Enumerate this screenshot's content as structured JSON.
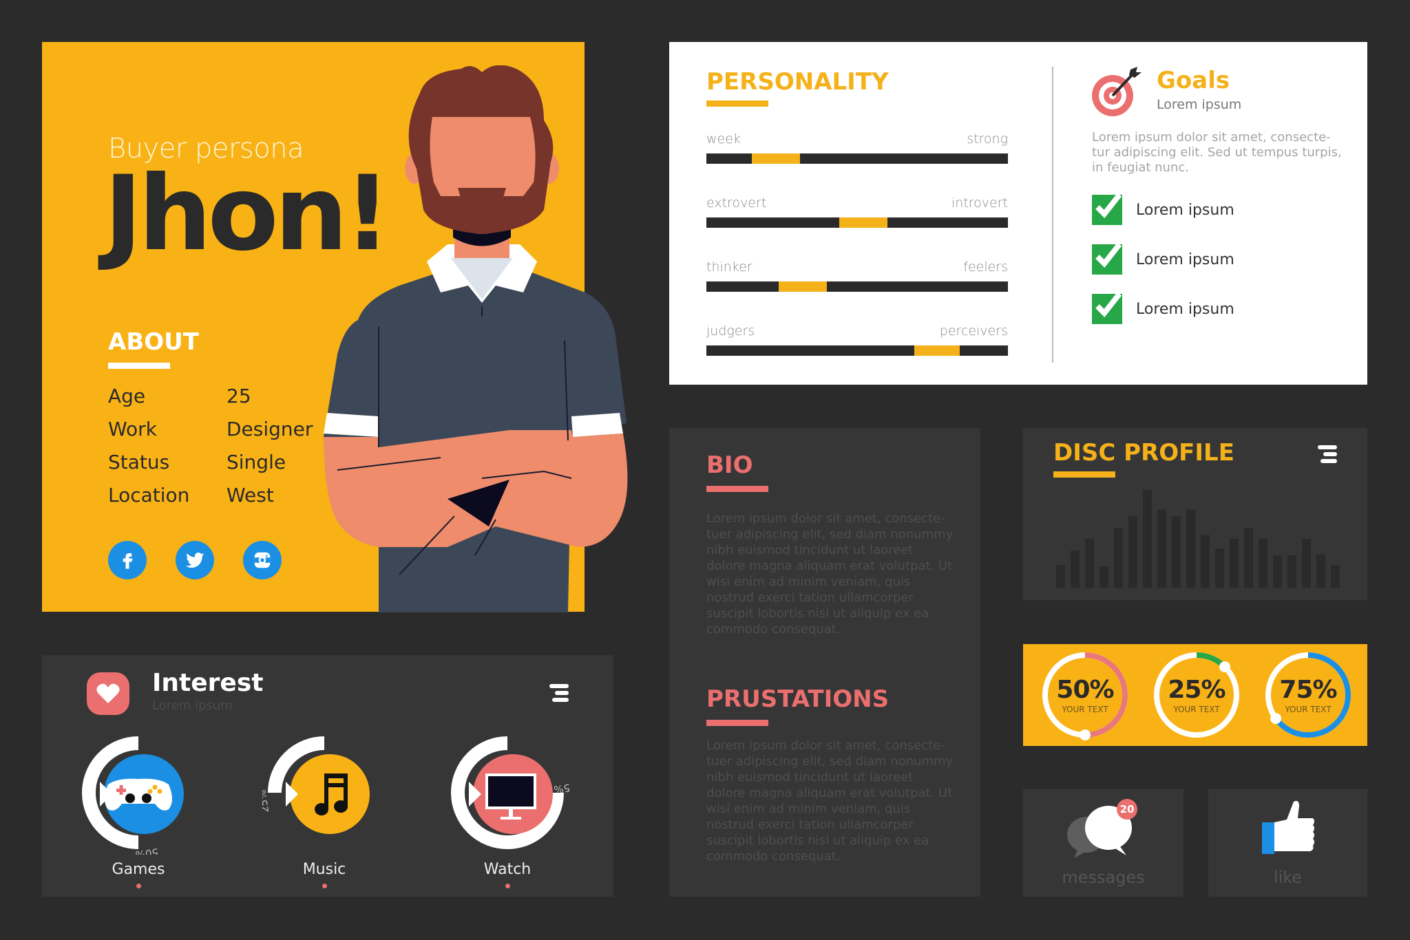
{
  "hero": {
    "subtitle": "Buyer persona",
    "name": "Jhon!",
    "about_heading": "ABOUT",
    "about": [
      {
        "label": "Age",
        "value": "25"
      },
      {
        "label": "Work",
        "value": "Designer"
      },
      {
        "label": "Status",
        "value": "Single"
      },
      {
        "label": "Location",
        "value": "West"
      }
    ],
    "social": [
      {
        "icon": "facebook-icon"
      },
      {
        "icon": "twitter-icon"
      },
      {
        "icon": "instagram-icon"
      }
    ]
  },
  "personality": {
    "title": "PERSONALITY",
    "traits": [
      {
        "left": "week",
        "right": "strong",
        "start": 0.15,
        "end": 0.31
      },
      {
        "left": "extrovert",
        "right": "introvert",
        "start": 0.44,
        "end": 0.6
      },
      {
        "left": "thinker",
        "right": "feelers",
        "start": 0.24,
        "end": 0.4
      },
      {
        "left": "judgers",
        "right": "perceivers",
        "start": 0.69,
        "end": 0.84
      }
    ]
  },
  "goals": {
    "title": "Goals",
    "subtitle": "Lorem ipsum",
    "text": "Lorem ipsum dolor sit amet, consecte-tur adipiscing elit. Sed ut tempus turpis, in feugiat nunc.",
    "items": [
      "Lorem ipsum",
      "Lorem ipsum",
      "Lorem ipsum"
    ]
  },
  "bio": {
    "title": "BIO",
    "text": "Lorem ipsum dolor sit amet, consecte-tuer adipiscing elit, sed diam nonummy nibh euismod tincidunt ut laoreet dolore magna aliquam erat volutpat. Ut wisi enim ad minim veniam, quis nostrud exerci tation ullamcorper suscipit lobortis nisl ut aliquip ex ea commodo consequat."
  },
  "frustrations": {
    "title": "PRUSTATIONS",
    "text": "Lorem ipsum dolor sit amet, consecte-tuer adipiscing elit, sed diam nonummy nibh euismod tincidunt ut laoreet dolore magna aliquam erat volutpat. Ut wisi enim ad minim veniam, quis nostrud exerci tation ullamcorper suscipit lobortis nisl ut aliquip ex ea commodo consequat."
  },
  "disc": {
    "title": "DISC PROFILE",
    "bars": [
      0.23,
      0.38,
      0.5,
      0.22,
      0.61,
      0.73,
      1.0,
      0.8,
      0.73,
      0.8,
      0.54,
      0.4,
      0.5,
      0.61,
      0.5,
      0.33,
      0.33,
      0.5,
      0.34,
      0.23
    ]
  },
  "stats": [
    {
      "value": "50%",
      "caption": "YOUR TEXT",
      "fraction": 0.5,
      "color": "#e8787a"
    },
    {
      "value": "25%",
      "caption": "YOUR TEXT",
      "fraction": 0.125,
      "color": "#27a748"
    },
    {
      "value": "75%",
      "caption": "YOUR TEXT",
      "fraction": 0.65,
      "color": "#1a8fe3"
    }
  ],
  "messages": {
    "label": "messages",
    "badge": "20"
  },
  "like": {
    "label": "like"
  },
  "interest": {
    "title": "Interest",
    "subtitle": "Lorem ipsum",
    "items": [
      {
        "label": "Games",
        "percent": "50%",
        "fraction": 0.5,
        "color": "#1a8fe3"
      },
      {
        "label": "Music",
        "percent": "25%",
        "fraction": 0.25,
        "color": "#f9b215"
      },
      {
        "label": "Watch",
        "percent": "75%",
        "fraction": 0.75,
        "color": "#ec6f6f"
      }
    ]
  },
  "colors": {
    "accent": "#f9b215",
    "pink": "#ec6f6f",
    "blue": "#1a8fe3",
    "green": "#27a748",
    "dark": "#2b2b2b",
    "panel": "#363636"
  }
}
